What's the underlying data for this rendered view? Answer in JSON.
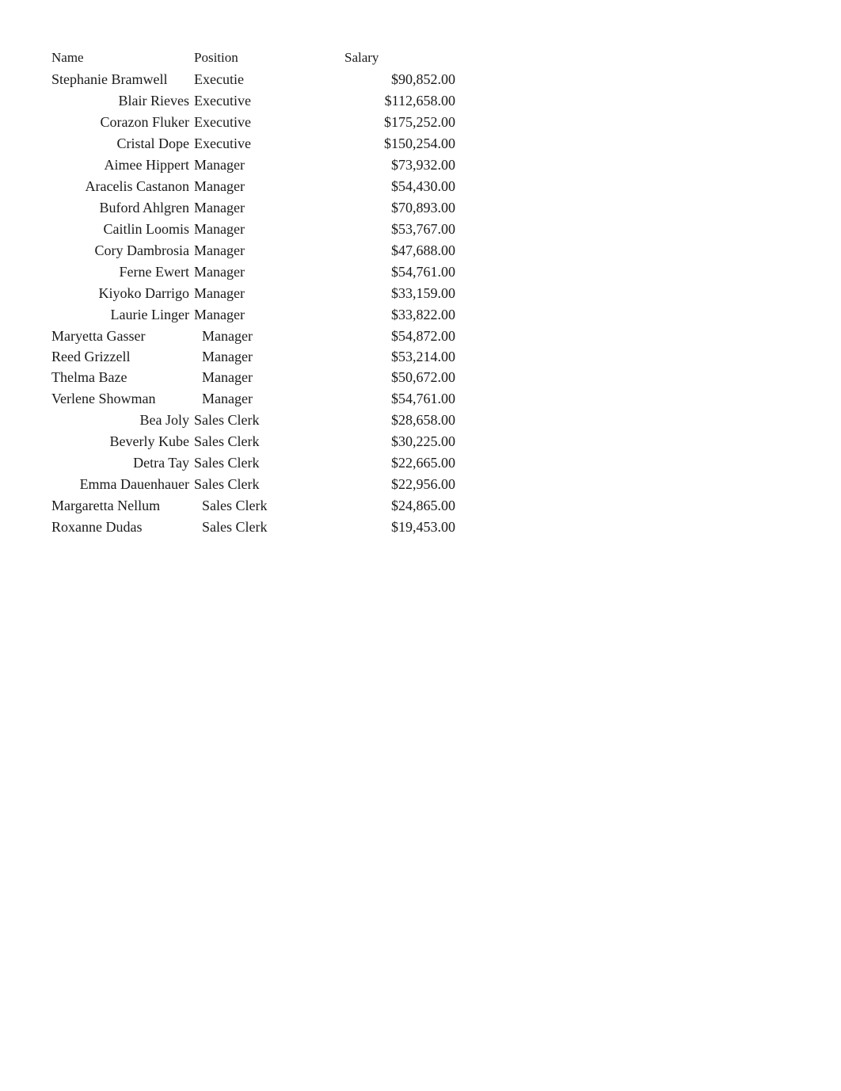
{
  "headers": {
    "name": "Name",
    "position": "Position",
    "salary": "Salary"
  },
  "rows": [
    {
      "name": "Stephanie Bramwell",
      "position": "Executie",
      "salary": "$90,852.00",
      "nameAlign": "left",
      "posPad": false
    },
    {
      "name": "Blair Rieves",
      "position": "Executive",
      "salary": "$112,658.00",
      "nameAlign": "right",
      "posPad": false
    },
    {
      "name": "Corazon Fluker",
      "position": "Executive",
      "salary": "$175,252.00",
      "nameAlign": "right",
      "posPad": false
    },
    {
      "name": "Cristal Dope",
      "position": "Executive",
      "salary": "$150,254.00",
      "nameAlign": "right",
      "posPad": false
    },
    {
      "name": "Aimee Hippert",
      "position": "Manager",
      "salary": "$73,932.00",
      "nameAlign": "right",
      "posPad": false
    },
    {
      "name": "Aracelis Castanon",
      "position": "Manager",
      "salary": "$54,430.00",
      "nameAlign": "right",
      "posPad": false
    },
    {
      "name": "Buford Ahlgren",
      "position": "Manager",
      "salary": "$70,893.00",
      "nameAlign": "right",
      "posPad": false
    },
    {
      "name": "Caitlin Loomis",
      "position": "Manager",
      "salary": "$53,767.00",
      "nameAlign": "right",
      "posPad": false
    },
    {
      "name": "Cory Dambrosia",
      "position": "Manager",
      "salary": "$47,688.00",
      "nameAlign": "right",
      "posPad": false
    },
    {
      "name": "Ferne Ewert",
      "position": "Manager",
      "salary": "$54,761.00",
      "nameAlign": "right",
      "posPad": false
    },
    {
      "name": "Kiyoko Darrigo",
      "position": "Manager",
      "salary": "$33,159.00",
      "nameAlign": "right",
      "posPad": false
    },
    {
      "name": "Laurie Linger",
      "position": "Manager",
      "salary": "$33,822.00",
      "nameAlign": "right",
      "posPad": false
    },
    {
      "name": "Maryetta Gasser",
      "position": "Manager",
      "salary": "$54,872.00",
      "nameAlign": "left",
      "posPad": true
    },
    {
      "name": "Reed Grizzell",
      "position": "Manager",
      "salary": "$53,214.00",
      "nameAlign": "left",
      "posPad": true,
      "tight": true
    },
    {
      "name": "Thelma Baze",
      "position": "Manager",
      "salary": "$50,672.00",
      "nameAlign": "left",
      "posPad": true
    },
    {
      "name": "Verlene Showman",
      "position": "Manager",
      "salary": "$54,761.00",
      "nameAlign": "left",
      "posPad": true
    },
    {
      "name": "Bea Joly",
      "position": "Sales Clerk",
      "salary": "$28,658.00",
      "nameAlign": "right",
      "posPad": false
    },
    {
      "name": "Beverly Kube",
      "position": "Sales Clerk",
      "salary": "$30,225.00",
      "nameAlign": "right",
      "posPad": false
    },
    {
      "name": "Detra Tay",
      "position": "Sales Clerk",
      "salary": "$22,665.00",
      "nameAlign": "right",
      "posPad": false
    },
    {
      "name": "Emma Dauenhauer",
      "position": "Sales Clerk",
      "salary": "$22,956.00",
      "nameAlign": "right",
      "posPad": false
    },
    {
      "name": "Margaretta Nellum",
      "position": "Sales Clerk",
      "salary": "$24,865.00",
      "nameAlign": "left",
      "posPad": true
    },
    {
      "name": "Roxanne Dudas",
      "position": "Sales Clerk",
      "salary": "$19,453.00",
      "nameAlign": "left",
      "posPad": true
    }
  ]
}
